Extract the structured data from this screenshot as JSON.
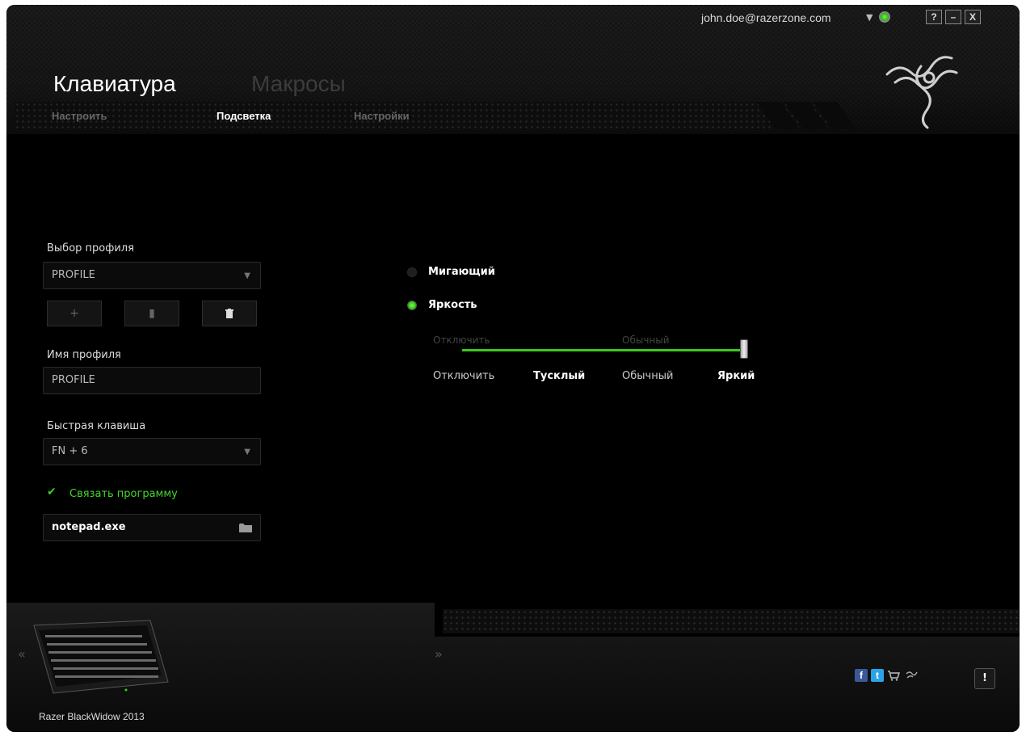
{
  "window": {
    "account_email": "john.doe@razerzone.com",
    "help_label": "?",
    "minimize_label": "–",
    "close_label": "X"
  },
  "header": {
    "tabs": [
      {
        "label": "Клавиатура",
        "active": true
      },
      {
        "label": "Макросы",
        "active": false
      }
    ],
    "subtabs": [
      {
        "label": "Настроить",
        "active": false
      },
      {
        "label": "Подсветка",
        "active": true
      },
      {
        "label": "Настройки",
        "active": false
      }
    ],
    "logo_icon": "razer-snake-logo"
  },
  "profile_panel": {
    "select_label": "Выбор профиля",
    "selected_profile": "PROFILE",
    "add_label": "+",
    "copy_icon": "copy-icon",
    "delete_icon": "trash-icon",
    "name_label": "Имя профиля",
    "name_value": "PROFILE",
    "hotkey_label": "Быстрая клавиша",
    "hotkey_value": "FN + 6",
    "link_program_label": "Связать программу",
    "link_program_checked": true,
    "program_value": "notepad.exe"
  },
  "lighting": {
    "options": [
      {
        "label": "Мигающий",
        "selected": false
      },
      {
        "label": "Яркость",
        "selected": true
      }
    ],
    "faded_labels": [
      "Отключить",
      "Обычный"
    ],
    "levels": [
      "Отключить",
      "Тусклый",
      "Обычный",
      "Яркий"
    ],
    "current_level": "Яркий",
    "accent_color": "#44d62c"
  },
  "footer": {
    "device_name": "Razer BlackWidow 2013",
    "prev_label": "«",
    "next_label": "»",
    "social_icons": [
      "facebook-icon",
      "twitter-icon",
      "cart-icon",
      "razer-icon"
    ],
    "alert_label": "!"
  }
}
